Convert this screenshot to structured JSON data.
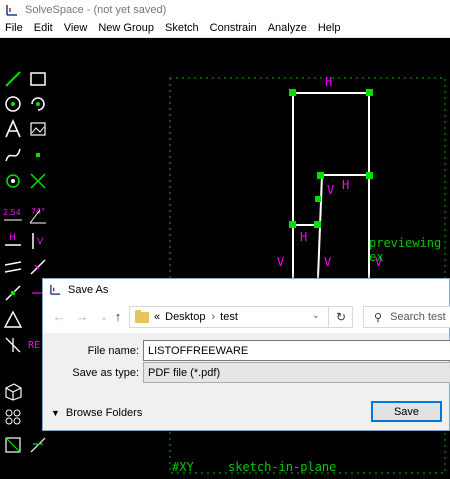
{
  "window": {
    "title": "SolveSpace - (not yet saved)"
  },
  "menu": [
    "File",
    "Edit",
    "View",
    "New Group",
    "Sketch",
    "Constrain",
    "Analyze",
    "Help"
  ],
  "canvas": {
    "constraint_labels": [
      "H",
      "H",
      "V",
      "H",
      "V",
      "V",
      "V"
    ],
    "status_text": "previewing ex",
    "workplane_label": "#XY",
    "sketch_label": "sketch-in-plane",
    "toolbar_texts": {
      "dimension": "2.54",
      "angle": "74°",
      "ref": "RE"
    },
    "colors": {
      "sketch": "#ffffff",
      "points": "#00e000",
      "constraints": "#ff00ff",
      "workplane": "#00c800"
    }
  },
  "dialog": {
    "title": "Save As",
    "breadcrumb": [
      "Desktop",
      "test"
    ],
    "breadcrumb_prefix": "«",
    "search_placeholder": "Search test",
    "file_name_label": "File name:",
    "file_name_value": "LISTOFFREEWARE",
    "save_as_type_label": "Save as type:",
    "save_as_type_value": "PDF file (*.pdf)",
    "browse_folders_label": "Browse Folders",
    "save_button": "Save"
  }
}
